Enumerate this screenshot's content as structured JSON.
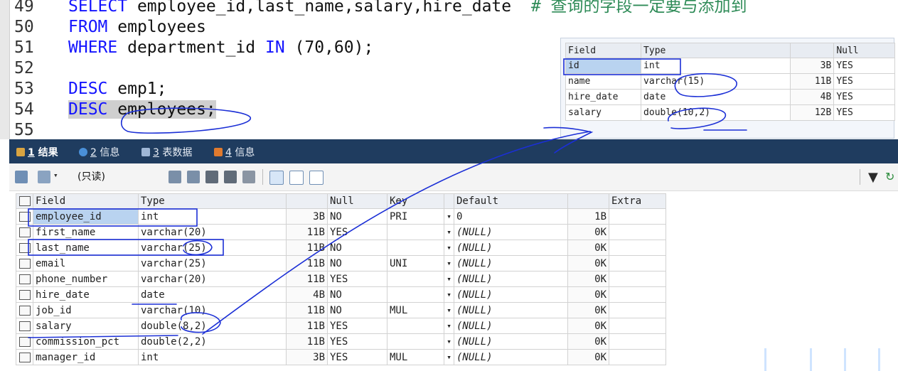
{
  "editor": {
    "lines": [
      {
        "num": "49",
        "parts": [
          {
            "t": "SELECT ",
            "c": "kw"
          },
          {
            "t": "employee_id,last_name,salary,hire_date  ",
            "c": ""
          },
          {
            "t": "# 查询的字段一定要与添加到",
            "c": "cm"
          }
        ]
      },
      {
        "num": "50",
        "parts": [
          {
            "t": "FROM ",
            "c": "kw"
          },
          {
            "t": "employees",
            "c": ""
          }
        ]
      },
      {
        "num": "51",
        "parts": [
          {
            "t": "WHERE ",
            "c": "kw"
          },
          {
            "t": "department_id ",
            "c": ""
          },
          {
            "t": "IN ",
            "c": "kw"
          },
          {
            "t": "(70,60);",
            "c": ""
          }
        ]
      },
      {
        "num": "52",
        "parts": []
      },
      {
        "num": "53",
        "parts": [
          {
            "t": "DESC ",
            "c": "kw"
          },
          {
            "t": "emp1;",
            "c": ""
          }
        ]
      },
      {
        "num": "54",
        "parts": [
          {
            "t": "DESC ",
            "c": "kw hl"
          },
          {
            "t": "employees;",
            "c": "hl"
          }
        ]
      },
      {
        "num": "55",
        "parts": []
      }
    ]
  },
  "small_table": {
    "headers": [
      "Field",
      "Type",
      "",
      "Null"
    ],
    "rows": [
      {
        "field": "id",
        "type": "int",
        "size": "3B",
        "null": "YES"
      },
      {
        "field": "name",
        "type": "varchar(15)",
        "size": "11B",
        "null": "YES"
      },
      {
        "field": "hire_date",
        "type": "date",
        "size": "4B",
        "null": "YES"
      },
      {
        "field": "salary",
        "type": "double(10,2)",
        "size": "12B",
        "null": "YES"
      }
    ]
  },
  "tabs": [
    {
      "num": "1",
      "label": "结果",
      "icon_color": "#d9a441"
    },
    {
      "num": "2",
      "label": "信息",
      "icon_color": "#4a90d9"
    },
    {
      "num": "3",
      "label": "表数据",
      "icon_color": "#9fb7d6"
    },
    {
      "num": "4",
      "label": "信息",
      "icon_color": "#e07a2e"
    }
  ],
  "toolbar": {
    "readonly_label": "(只读)",
    "icons": [
      "grid-export-icon",
      "grid-options-icon",
      "copy-row-icon",
      "paste-row-icon",
      "save-icon",
      "delete-icon",
      "cancel-icon",
      "grid-view-icon",
      "form-view-icon",
      "text-view-icon"
    ],
    "filter_icon": "filter-icon"
  },
  "main_table": {
    "headers": [
      "Field",
      "Type",
      "",
      "Null",
      "Key",
      "",
      "Default",
      "",
      "Extra"
    ],
    "rows": [
      {
        "field": "employee_id",
        "type": "int",
        "size": "3B",
        "null": "NO",
        "key": "PRI",
        "default": "0",
        "dsize": "1B",
        "extra": ""
      },
      {
        "field": "first_name",
        "type": "varchar(20)",
        "size": "11B",
        "null": "YES",
        "key": "",
        "default": "(NULL)",
        "dsize": "0K",
        "extra": ""
      },
      {
        "field": "last_name",
        "type": "varchar(25)",
        "size": "11B",
        "null": "NO",
        "key": "",
        "default": "(NULL)",
        "dsize": "0K",
        "extra": ""
      },
      {
        "field": "email",
        "type": "varchar(25)",
        "size": "11B",
        "null": "NO",
        "key": "UNI",
        "default": "(NULL)",
        "dsize": "0K",
        "extra": ""
      },
      {
        "field": "phone_number",
        "type": "varchar(20)",
        "size": "11B",
        "null": "YES",
        "key": "",
        "default": "(NULL)",
        "dsize": "0K",
        "extra": ""
      },
      {
        "field": "hire_date",
        "type": "date",
        "size": "4B",
        "null": "NO",
        "key": "",
        "default": "(NULL)",
        "dsize": "0K",
        "extra": ""
      },
      {
        "field": "job_id",
        "type": "varchar(10)",
        "size": "11B",
        "null": "NO",
        "key": "MUL",
        "default": "(NULL)",
        "dsize": "0K",
        "extra": ""
      },
      {
        "field": "salary",
        "type": "double(8,2)",
        "size": "11B",
        "null": "YES",
        "key": "",
        "default": "(NULL)",
        "dsize": "0K",
        "extra": ""
      },
      {
        "field": "commission_pct",
        "type": "double(2,2)",
        "size": "11B",
        "null": "YES",
        "key": "",
        "default": "(NULL)",
        "dsize": "0K",
        "extra": ""
      },
      {
        "field": "manager_id",
        "type": "int",
        "size": "3B",
        "null": "YES",
        "key": "MUL",
        "default": "(NULL)",
        "dsize": "0K",
        "extra": ""
      }
    ]
  },
  "colors": {
    "accent_tab_bar": "#1f3c5f",
    "keyword": "#1414ff",
    "comment": "#2e8b57",
    "ink": "#1b2fd6",
    "selection": "#b9d3f0"
  }
}
